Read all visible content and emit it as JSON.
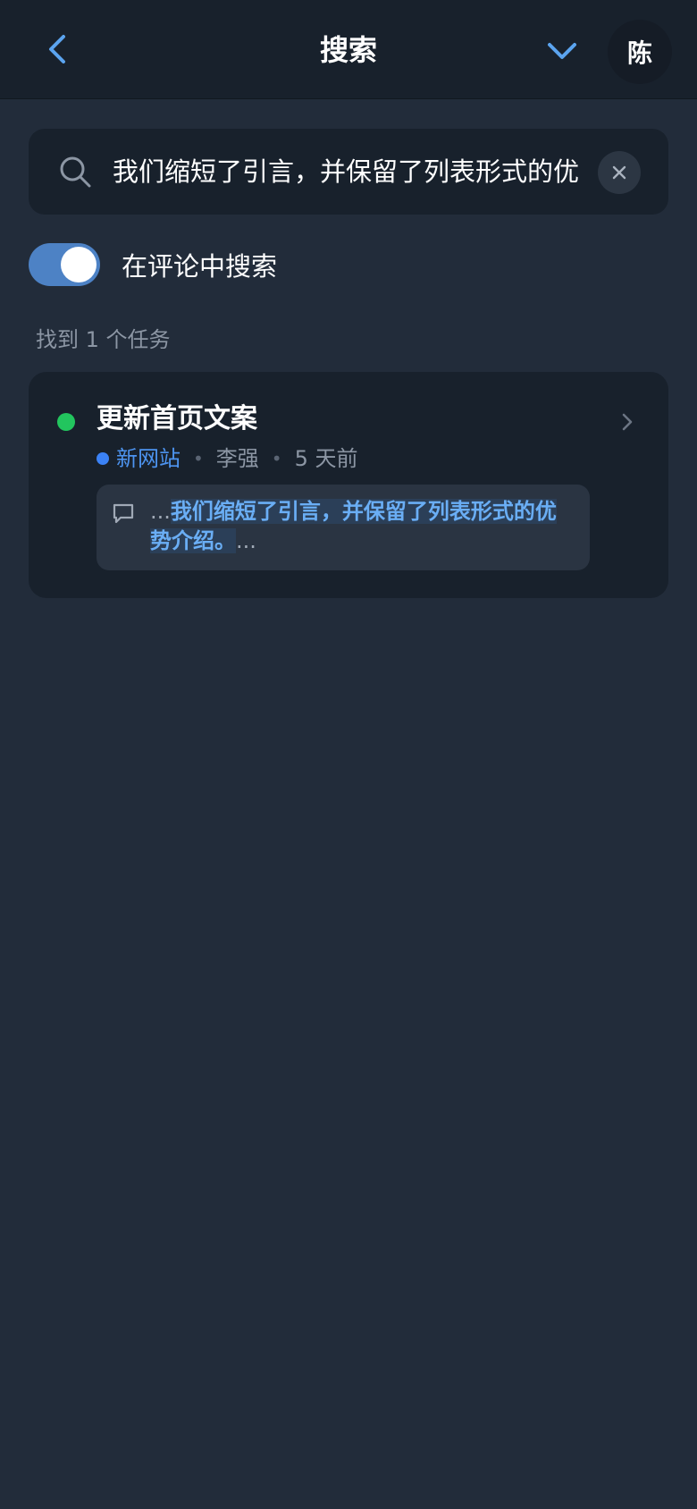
{
  "header": {
    "title": "搜索",
    "avatar_text": "陈"
  },
  "search": {
    "value": "我们缩短了引言，并保留了列表形式的优",
    "placeholder": ""
  },
  "toggle": {
    "label": "在评论中搜索",
    "checked": true
  },
  "results": {
    "count_text": "找到 1 个任务"
  },
  "task": {
    "title": "更新首页文案",
    "project": "新网站",
    "assignee": "李强",
    "time": "5 天前",
    "separator": "•",
    "comment_prefix": "...",
    "comment_highlight": "我们缩短了引言，并保留了列表形式的优势介绍。",
    "comment_suffix": "..."
  },
  "colors": {
    "accent": "#4d94f0",
    "status_green": "#22c55e",
    "project_blue": "#3b82f6",
    "background": "#222c3a",
    "card": "#18212c"
  },
  "icons": {
    "back": "chevron-left-icon",
    "dropdown": "chevron-down-icon",
    "search": "search-icon",
    "clear": "close-icon",
    "open": "chevron-right-icon",
    "comment": "comment-icon"
  }
}
